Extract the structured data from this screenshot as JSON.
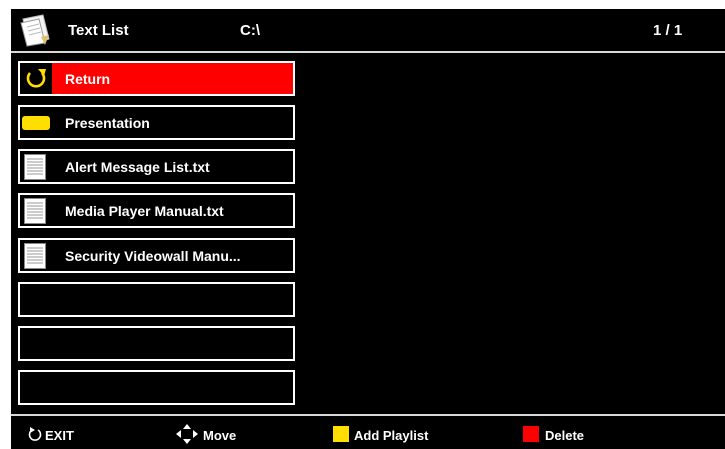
{
  "header": {
    "title": "Text List",
    "path": "C:\\",
    "page": "1 / 1",
    "icon": "notepad-icon"
  },
  "list": {
    "items": [
      {
        "label": "Return",
        "icon": "return-icon",
        "selected": true
      },
      {
        "label": "Presentation",
        "icon": "folder-icon",
        "selected": false
      },
      {
        "label": "Alert Message List.txt",
        "icon": "text-file-icon",
        "selected": false
      },
      {
        "label": "Media Player Manual.txt",
        "icon": "text-file-icon",
        "selected": false
      },
      {
        "label": "Security Videowall Manu...",
        "icon": "text-file-icon",
        "selected": false
      },
      {
        "label": "",
        "icon": "",
        "selected": false
      },
      {
        "label": "",
        "icon": "",
        "selected": false
      },
      {
        "label": "",
        "icon": "",
        "selected": false
      }
    ]
  },
  "footer": {
    "exit_label": "EXIT",
    "move_label": "Move",
    "add_playlist_label": "Add Playlist",
    "delete_label": "Delete"
  },
  "colors": {
    "background": "#000000",
    "selected": "#ff0000",
    "accent_yellow": "#ffde00",
    "accent_red": "#ff0000"
  }
}
